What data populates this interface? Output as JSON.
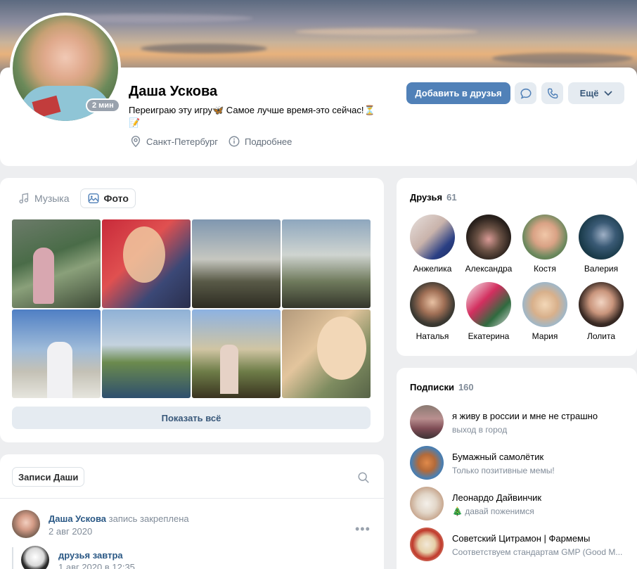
{
  "profile": {
    "name": "Даша Ускова",
    "status": "Переиграю эту игру🦋 Самое лучше время-это сейчас!⏳📝",
    "online_badge": "2 мин",
    "city": "Санкт-Петербург",
    "more_info": "Подробнее",
    "add_friend": "Добавить в друзья",
    "more_button": "Ещё"
  },
  "media": {
    "tabs": [
      {
        "label": "Музыка",
        "icon": "music-icon"
      },
      {
        "label": "Фото",
        "icon": "photo-icon"
      }
    ],
    "show_all": "Показать всё"
  },
  "wall": {
    "tab": "Записи Даши",
    "post": {
      "author": "Даша Ускова",
      "action": "запись закреплена",
      "date": "2 авг 2020",
      "repost_title": "друзья завтра",
      "repost_date": "1 авг 2020 в 12:35"
    }
  },
  "friends": {
    "title": "Друзья",
    "count": "61",
    "items": [
      {
        "name": "Анжелика"
      },
      {
        "name": "Александра"
      },
      {
        "name": "Костя"
      },
      {
        "name": "Валерия"
      },
      {
        "name": "Наталья"
      },
      {
        "name": "Екатерина"
      },
      {
        "name": "Мария"
      },
      {
        "name": "Лолита"
      }
    ]
  },
  "subscriptions": {
    "title": "Подписки",
    "count": "160",
    "items": [
      {
        "title": "я живу в россии и мне не страшно",
        "subtitle": "выход в город"
      },
      {
        "title": "Бумажный самолётик",
        "subtitle": "Только позитивные мемы!"
      },
      {
        "title": "Леонардо Дайвинчик",
        "subtitle": "🎄 давай поженимся"
      },
      {
        "title": "Советский Цитрамон | Фармемы",
        "subtitle": "Соответствуем стандартам GMP (Good M..."
      }
    ]
  },
  "colors": {
    "accent": "#5181b8",
    "link": "#2a5885",
    "secondary": "#818c99",
    "button_bg": "#e5ebf1"
  }
}
